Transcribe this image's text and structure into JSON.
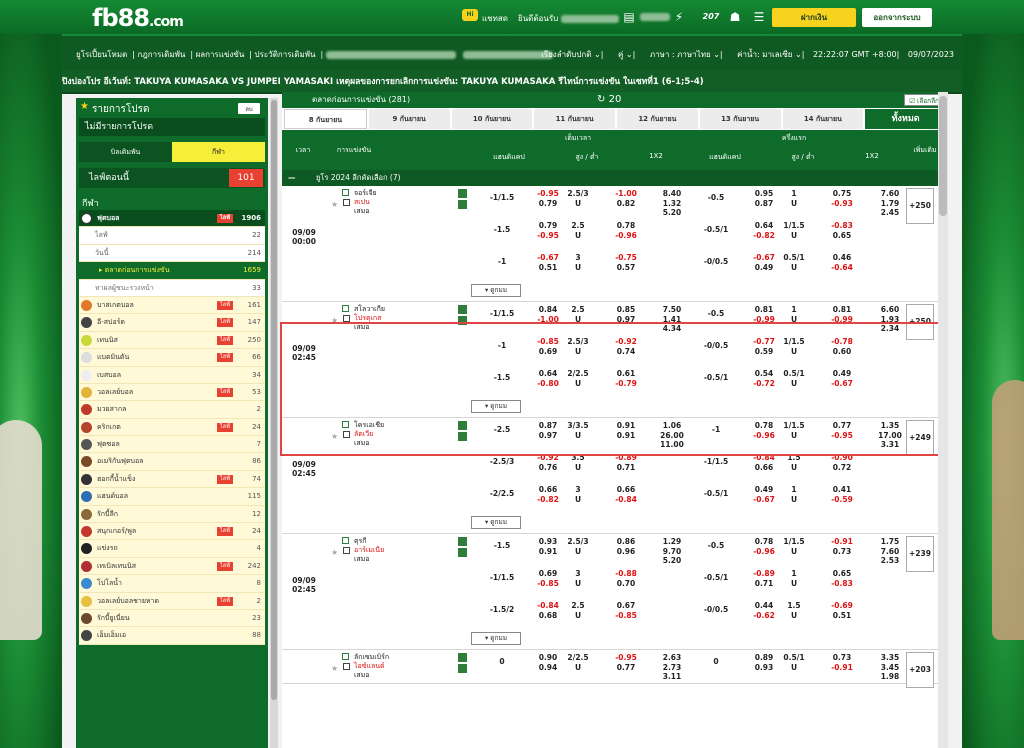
{
  "header": {
    "logo_main": "fb88",
    "logo_suffix": ".com",
    "chat_badge": "Hi",
    "chat_label": "แชทสด",
    "welcome": "ยินดีต้อนรับ",
    "deposit_btn": "ฝากเงิน",
    "logout_btn": "ออกจากระบบ"
  },
  "nav": {
    "left": [
      "ยูโรเปี้ยนโหมด",
      "กฎการเดิมพัน",
      "ผลการแข่งขัน",
      "ประวัติการเดิมพัน"
    ],
    "right": [
      "เรียงลำดับปกติ",
      "คู่",
      "ภาษา : ภาษาไทย",
      "ค่าน้ำ: มาเลเซีย",
      "22:22:07 GMT +8:00",
      "09/07/2023"
    ]
  },
  "ticker": "ปิงปองโปร อีเว้นท์: TAKUYA KUMASAKA VS JUMPEI YAMASAKI เหตุผลของการยกเลิกการแข่งขัน: TAKUYA KUMASAKA รีไทน์การแข่งขัน ในเซทที่1 (6-1;5-4)",
  "sidebar": {
    "my_bets_title": "รายการโปรด",
    "small_btn": "ลบ",
    "no_bets": "ไม่มีรายการโปรด",
    "tab_bet": "บิลเดิมพัน",
    "tab_sport": "กีฬา",
    "live_label": "ไลฟ์ตอนนี้",
    "live_count": "101",
    "sports_title": "กีฬา",
    "live_tag": "ไลฟ์",
    "football": {
      "label": "ฟุตบอล",
      "count": "1906"
    },
    "sub": [
      {
        "label": "ไลฟ์",
        "count": "22"
      },
      {
        "label": "วันนี้",
        "count": "214"
      },
      {
        "label": "ตลาดก่อนการแข่งขัน",
        "count": "1659"
      },
      {
        "label": "หาผลผู้ชนะรวงหน้า",
        "count": "33"
      }
    ],
    "sports": [
      {
        "label": "บาสเกตบอล",
        "count": "161",
        "live": true,
        "color": "#e07a2b"
      },
      {
        "label": "อี-สปอร์ต",
        "count": "147",
        "live": true,
        "color": "#444444"
      },
      {
        "label": "เทนนิส",
        "count": "250",
        "live": true,
        "color": "#c8d83a"
      },
      {
        "label": "แบดมินตัน",
        "count": "66",
        "live": true,
        "color": "#dddddd"
      },
      {
        "label": "เบสบอล",
        "count": "34",
        "live": false,
        "color": "#eeeeee"
      },
      {
        "label": "วอลเลย์บอล",
        "count": "53",
        "live": true,
        "color": "#e3b43a"
      },
      {
        "label": "มวยสากล",
        "count": "2",
        "live": false,
        "color": "#c0392b"
      },
      {
        "label": "คริกเกต",
        "count": "24",
        "live": true,
        "color": "#b5442e"
      },
      {
        "label": "ฟุตซอล",
        "count": "7",
        "live": false,
        "color": "#555555"
      },
      {
        "label": "อเมริกันฟุตบอล",
        "count": "86",
        "live": false,
        "color": "#7a4a25"
      },
      {
        "label": "ฮอกกี้น้ำแข็ง",
        "count": "74",
        "live": true,
        "color": "#333333"
      },
      {
        "label": "แฮนด์บอล",
        "count": "115",
        "live": false,
        "color": "#2c6db3"
      },
      {
        "label": "รักบี้ลีก",
        "count": "12",
        "live": false,
        "color": "#8a6a3a"
      },
      {
        "label": "สนุกเกอร์/พูล",
        "count": "24",
        "live": true,
        "color": "#c0392b"
      },
      {
        "label": "แข่งรถ",
        "count": "4",
        "live": false,
        "color": "#222222"
      },
      {
        "label": "เทเบิลเทนนิส",
        "count": "242",
        "live": true,
        "color": "#b03030"
      },
      {
        "label": "โปโลน้ำ",
        "count": "8",
        "live": false,
        "color": "#3a8ad0"
      },
      {
        "label": "วอลเลย์บอลชายหาด",
        "count": "2",
        "live": true,
        "color": "#e8c040"
      },
      {
        "label": "รักบี้ยูเนี่ยน",
        "count": "23",
        "live": false,
        "color": "#6a4a2a"
      },
      {
        "label": "เอ็มเอ็มเอ",
        "count": "88",
        "live": false,
        "color": "#444444"
      }
    ]
  },
  "content": {
    "header_title": "ตลาดก่อนการแข่งขัน (281)",
    "refresh_icon": "↻",
    "refresh_count": "20",
    "select_btn": "เลือกลีก",
    "dates": [
      "8 กันยายน",
      "9 กันยายน",
      "10 กันยายน",
      "11 กันยายน",
      "12 กันยายน",
      "13 กันยายน",
      "14 กันยายน",
      "ทั้งหมด"
    ],
    "cols": {
      "time": "เวลา",
      "event": "การแข่งขัน",
      "full_time": "เต็มเวลา",
      "first_half": "ครึ่งแรก",
      "handicap": "แฮนดิแคป",
      "ou": "สูง / ต่ำ",
      "x12": "1X2",
      "more": "เพิ่มเติม"
    },
    "league": "ยูโร 2024 ลีกคัดเลือก (7)",
    "more_label": "ดูกมม",
    "matches": [
      {
        "date": "09/09",
        "time": "00:00",
        "teams": [
          "จอร์เจีย",
          "สเปน",
          "เสมอ"
        ],
        "plus": "+250",
        "rows": [
          {
            "hdp": "-1/1.5",
            "ha": "-0.95",
            "hb": "0.79",
            "ou": "2.5/3",
            "oa": "-1.00",
            "ob": "0.82",
            "x": [
              "8.40",
              "1.32",
              "5.20"
            ],
            "h1": "-0.5",
            "h1a": "0.95",
            "h1b": "0.87",
            "ou1": "1",
            "o1a": "0.75",
            "o1b": "-0.93",
            "x1": [
              "7.60",
              "1.79",
              "2.45"
            ]
          },
          {
            "hdp": "-1.5",
            "ha": "0.79",
            "hb": "-0.95",
            "ou": "2.5",
            "oa": "0.78",
            "ob": "-0.96",
            "h1": "-0.5/1",
            "h1a": "0.64",
            "h1b": "-0.82",
            "ou1": "1/1.5",
            "o1a": "-0.83",
            "o1b": "0.65"
          },
          {
            "hdp": "-1",
            "ha": "-0.67",
            "hb": "0.51",
            "ou": "3",
            "oa": "-0.75",
            "ob": "0.57",
            "h1": "-0/0.5",
            "h1a": "-0.67",
            "h1b": "0.49",
            "ou1": "0.5/1",
            "o1a": "0.46",
            "o1b": "-0.64"
          }
        ]
      },
      {
        "date": "09/09",
        "time": "02:45",
        "teams": [
          "สโลวาเกีย",
          "โปรตุเกส",
          "เสมอ"
        ],
        "plus": "+250",
        "rows": [
          {
            "hdp": "-1/1.5",
            "ha": "0.84",
            "hb": "-1.00",
            "ou": "2.5",
            "oa": "0.85",
            "ob": "0.97",
            "x": [
              "7.50",
              "1.41",
              "4.34"
            ],
            "h1": "-0.5",
            "h1a": "0.81",
            "h1b": "-0.99",
            "ou1": "1",
            "o1a": "0.81",
            "o1b": "-0.99",
            "x1": [
              "6.60",
              "1.93",
              "2.34"
            ]
          },
          {
            "hdp": "-1",
            "ha": "-0.85",
            "hb": "0.69",
            "ou": "2.5/3",
            "oa": "-0.92",
            "ob": "0.74",
            "h1": "-0/0.5",
            "h1a": "-0.77",
            "h1b": "0.59",
            "ou1": "1/1.5",
            "o1a": "-0.78",
            "o1b": "0.60"
          },
          {
            "hdp": "-1.5",
            "ha": "0.64",
            "hb": "-0.80",
            "ou": "2/2.5",
            "oa": "0.61",
            "ob": "-0.79",
            "h1": "-0.5/1",
            "h1a": "0.54",
            "h1b": "-0.72",
            "ou1": "0.5/1",
            "o1a": "0.49",
            "o1b": "-0.67"
          }
        ]
      },
      {
        "date": "09/09",
        "time": "02:45",
        "teams": [
          "โครเอเชีย",
          "ลัตเวีย",
          "เสมอ"
        ],
        "plus": "+249",
        "rows": [
          {
            "hdp": "-2.5",
            "ha": "0.87",
            "hb": "0.97",
            "ou": "3/3.5",
            "oa": "0.91",
            "ob": "0.91",
            "x": [
              "1.06",
              "26.00",
              "11.00"
            ],
            "h1": "-1",
            "h1a": "0.78",
            "h1b": "-0.96",
            "ou1": "1/1.5",
            "o1a": "0.77",
            "o1b": "-0.95",
            "x1": [
              "1.35",
              "17.00",
              "3.31"
            ]
          },
          {
            "hdp": "-2.5/3",
            "ha": "-0.92",
            "hb": "0.76",
            "ou": "3.5",
            "oa": "-0.89",
            "ob": "0.71",
            "h1": "-1/1.5",
            "h1a": "-0.84",
            "h1b": "0.66",
            "ou1": "1.5",
            "o1a": "-0.90",
            "o1b": "0.72"
          },
          {
            "hdp": "-2/2.5",
            "ha": "0.66",
            "hb": "-0.82",
            "ou": "3",
            "oa": "0.66",
            "ob": "-0.84",
            "h1": "-0.5/1",
            "h1a": "0.49",
            "h1b": "-0.67",
            "ou1": "1",
            "o1a": "0.41",
            "o1b": "-0.59"
          }
        ]
      },
      {
        "date": "09/09",
        "time": "02:45",
        "teams": [
          "ตุรกี",
          "อาร์เมเนีย",
          "เสมอ"
        ],
        "plus": "+239",
        "rows": [
          {
            "hdp": "-1.5",
            "ha": "0.93",
            "hb": "0.91",
            "ou": "2.5/3",
            "oa": "0.86",
            "ob": "0.96",
            "x": [
              "1.29",
              "9.70",
              "5.20"
            ],
            "h1": "-0.5",
            "h1a": "0.78",
            "h1b": "-0.96",
            "ou1": "1/1.5",
            "o1a": "-0.91",
            "o1b": "0.73",
            "x1": [
              "1.75",
              "7.60",
              "2.53"
            ]
          },
          {
            "hdp": "-1/1.5",
            "ha": "0.69",
            "hb": "-0.85",
            "ou": "3",
            "oa": "-0.88",
            "ob": "0.70",
            "h1": "-0.5/1",
            "h1a": "-0.89",
            "h1b": "0.71",
            "ou1": "1",
            "o1a": "0.65",
            "o1b": "-0.83"
          },
          {
            "hdp": "-1.5/2",
            "ha": "-0.84",
            "hb": "0.68",
            "ou": "2.5",
            "oa": "0.67",
            "ob": "-0.85",
            "h1": "-0/0.5",
            "h1a": "0.44",
            "h1b": "-0.62",
            "ou1": "1.5",
            "o1a": "-0.69",
            "o1b": "0.51"
          }
        ]
      },
      {
        "date": "",
        "time": "",
        "teams": [
          "ลักเซมเบิร์ก",
          "ไอซ์แลนด์",
          "เสมอ"
        ],
        "plus": "+203",
        "rows": [
          {
            "hdp": "0",
            "ha": "0.90",
            "hb": "0.94",
            "ou": "2/2.5",
            "oa": "-0.95",
            "ob": "0.77",
            "x": [
              "2.63",
              "2.73",
              "3.11"
            ],
            "h1": "0",
            "h1a": "0.89",
            "h1b": "0.93",
            "ou1": "0.5/1",
            "o1a": "0.73",
            "o1b": "-0.91",
            "x1": [
              "3.35",
              "3.45",
              "1.98"
            ]
          }
        ]
      }
    ]
  }
}
